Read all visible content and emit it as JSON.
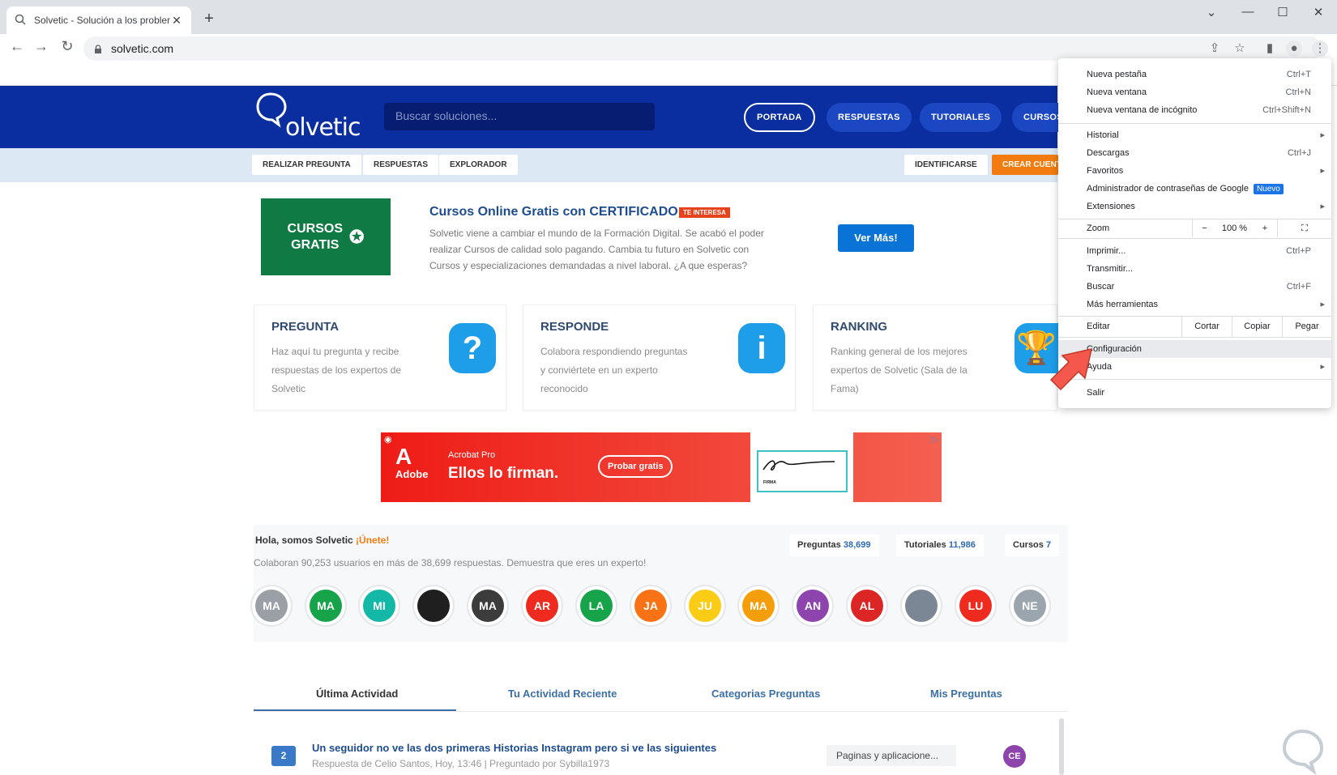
{
  "browser": {
    "tab_title": "Solvetic - Solución a los problem",
    "url": "solvetic.com"
  },
  "site": {
    "logo_text": "olvetic",
    "search_placeholder": "Buscar soluciones...",
    "nav": [
      "PORTADA",
      "RESPUESTAS",
      "TUTORIALES",
      "CURSOS"
    ],
    "subnav": [
      "REALIZAR PREGUNTA",
      "RESPUESTAS",
      "EXPLORADOR"
    ],
    "identificarse": "IDENTIFICARSE",
    "crear_cuenta": "CREAR CUENTA"
  },
  "promo": {
    "badge_line1": "CURSOS",
    "badge_line2": "GRATIS",
    "title": "Cursos Online Gratis con CERTIFICADO",
    "tag": "TE INTERESA",
    "description": "Solvetic viene a cambiar el mundo de la Formación Digital. Se acabó el poder realizar Cursos de calidad solo pagando. Cambia tu futuro en Solvetic con Cursos y especializaciones demandadas a nivel laboral. ¿A que esperas?",
    "button": "Ver Más!"
  },
  "cards": [
    {
      "title": "PREGUNTA",
      "text": "Haz aquí tu pregunta y recibe respuestas de los expertos de Solvetic",
      "icon": "question-icon"
    },
    {
      "title": "RESPONDE",
      "text": "Colabora respondiendo preguntas y conviértete en un experto reconocido",
      "icon": "info-icon"
    },
    {
      "title": "RANKING",
      "text": "Ranking general de los mejores expertos de Solvetic (Sala de la Fama)",
      "icon": "trophy-icon"
    }
  ],
  "ad": {
    "brand": "Adobe",
    "product": "Acrobat Pro",
    "headline": "Ellos lo firman.",
    "cta": "Probar gratis",
    "sig_label": "FIRMA"
  },
  "community": {
    "hello": "Hola, somos Solvetic",
    "join": "¡Únete!",
    "collab": "Colaboran 90,253 usuarios en más de 38,699 respuestas. Demuestra que eres un experto!",
    "stats": [
      {
        "label": "Preguntas",
        "value": "38,699"
      },
      {
        "label": "Tutoriales",
        "value": "11,986"
      },
      {
        "label": "Cursos",
        "value": "7"
      }
    ],
    "avatars": [
      {
        "initials": "MA",
        "color": "#9aa0a6"
      },
      {
        "initials": "MA",
        "color": "#16a34a"
      },
      {
        "initials": "MI",
        "color": "#14b8a6"
      },
      {
        "initials": "",
        "color": "#1f1f1f"
      },
      {
        "initials": "MA",
        "color": "#3c3c3c"
      },
      {
        "initials": "AR",
        "color": "#ef2b1f"
      },
      {
        "initials": "LA",
        "color": "#16a34a"
      },
      {
        "initials": "JA",
        "color": "#f97316"
      },
      {
        "initials": "JU",
        "color": "#facc15"
      },
      {
        "initials": "MA",
        "color": "#f59e0b"
      },
      {
        "initials": "AN",
        "color": "#8e44ad"
      },
      {
        "initials": "AL",
        "color": "#dc2626"
      },
      {
        "initials": "",
        "color": "#7b8794"
      },
      {
        "initials": "LU",
        "color": "#ef2b1f"
      },
      {
        "initials": "NE",
        "color": "#9aa5ad"
      }
    ]
  },
  "activity": {
    "tabs": [
      "Última Actividad",
      "Tu Actividad Reciente",
      "Categorias Preguntas",
      "Mis Preguntas"
    ],
    "question": {
      "count": "2",
      "title": "Un seguidor no ve las dos primeras Historias Instagram pero si ve las siguientes",
      "meta": "Respuesta de Celio Santos, Hoy, 13:46  |  Preguntado por Sybilla1973",
      "category": "Paginas y aplicacione...",
      "avatar": "CE"
    }
  },
  "menu": {
    "nueva_pestana": {
      "label": "Nueva pestaña",
      "shortcut": "Ctrl+T"
    },
    "nueva_ventana": {
      "label": "Nueva ventana",
      "shortcut": "Ctrl+N"
    },
    "incognito": {
      "label": "Nueva ventana de incógnito",
      "shortcut": "Ctrl+Shift+N"
    },
    "historial": {
      "label": "Historial"
    },
    "descargas": {
      "label": "Descargas",
      "shortcut": "Ctrl+J"
    },
    "favoritos": {
      "label": "Favoritos"
    },
    "passwords": {
      "label": "Administrador de contraseñas de Google",
      "badge": "Nuevo"
    },
    "extensiones": {
      "label": "Extensiones"
    },
    "zoom": {
      "label": "Zoom",
      "minus": "−",
      "value": "100 %",
      "plus": "+"
    },
    "imprimir": {
      "label": "Imprimir...",
      "shortcut": "Ctrl+P"
    },
    "transmitir": {
      "label": "Transmitir..."
    },
    "buscar": {
      "label": "Buscar",
      "shortcut": "Ctrl+F"
    },
    "herramientas": {
      "label": "Más herramientas"
    },
    "editar": {
      "label": "Editar",
      "cortar": "Cortar",
      "copiar": "Copiar",
      "pegar": "Pegar"
    },
    "configuracion": {
      "label": "Configuración"
    },
    "ayuda": {
      "label": "Ayuda"
    },
    "salir": {
      "label": "Salir"
    }
  }
}
